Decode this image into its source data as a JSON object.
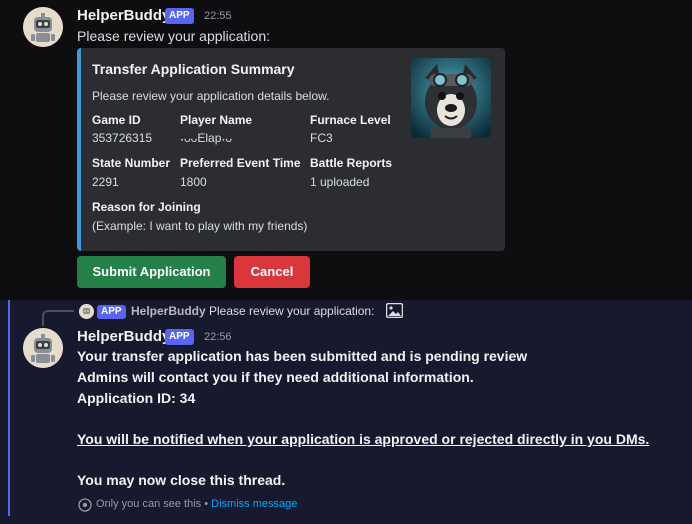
{
  "message1": {
    "username": "HelperBuddy",
    "badge": "APP",
    "time": "22:55",
    "text": "Please review your application:",
    "embed": {
      "title": "Transfer Application Summary",
      "description": "Please review your application details below.",
      "fields": [
        {
          "name": "Game ID",
          "value": "353726315"
        },
        {
          "name": "Player Name",
          "value": "˖ᴗᴗElap˖ᴗ"
        },
        {
          "name": "Furnace Level",
          "value": "FC3"
        },
        {
          "name": "State Number",
          "value": "2291"
        },
        {
          "name": "Preferred Event Time",
          "value": "1800"
        },
        {
          "name": "Battle Reports",
          "value": "1 uploaded"
        },
        {
          "name": "Reason for Joining",
          "value": "(Example: I want to play with my friends)"
        }
      ],
      "accent_color": "#3b9bdc"
    },
    "buttons": {
      "submit": "Submit Application",
      "cancel": "Cancel"
    }
  },
  "message2": {
    "reply": {
      "badge": "APP",
      "username": "HelperBuddy",
      "text": "Please review your application:",
      "icon": "image-icon"
    },
    "username": "HelperBuddy",
    "badge": "APP",
    "time": "22:56",
    "lines": [
      "Your transfer application has been submitted and is pending review",
      "Admins will contact you if they need additional information.",
      "Application ID: 34"
    ],
    "notice": "You will be notified when your application is approved or rejected directly in you DMs.",
    "closing": "You may now close this thread.",
    "footer": {
      "visibility_text": "Only you can see this • ",
      "dismiss_link": "Dismiss message",
      "icon": "eye-icon"
    }
  },
  "colors": {
    "background": "#0e0e10",
    "ephemeral_background": "#171a2e",
    "accent": "#5865f2",
    "submit_green": "#248046",
    "cancel_red": "#da373c",
    "link": "#00a8fc"
  }
}
